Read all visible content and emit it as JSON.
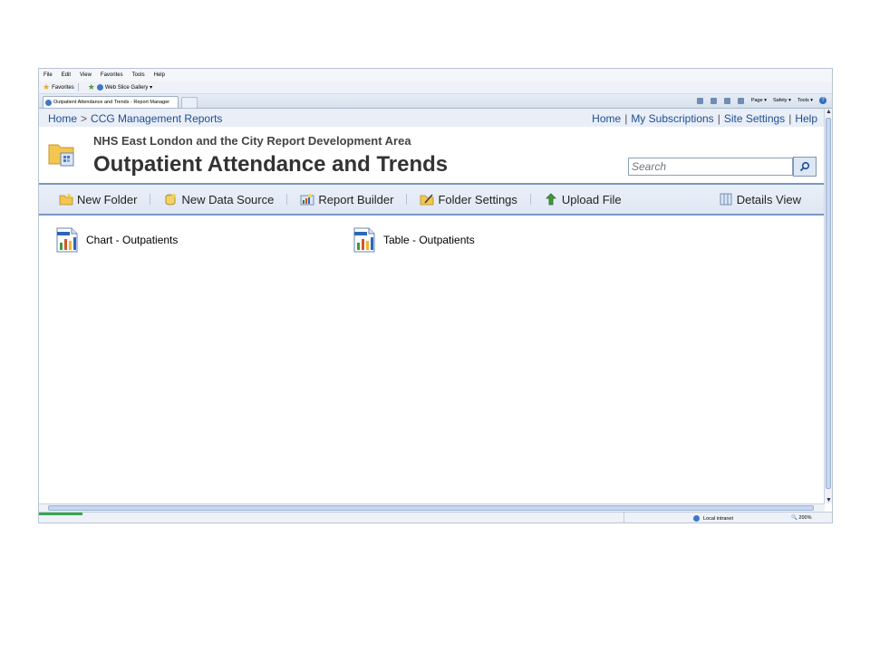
{
  "browser": {
    "menu": [
      "File",
      "Edit",
      "View",
      "Favorites",
      "Tools",
      "Help"
    ],
    "favorites_bar": {
      "favorites_label": "Favorites",
      "web_slice_label": "Web Slice Gallery ▾"
    },
    "tab_title": "Outpatient Attendance and Trends - Report Manager",
    "commands": {
      "page": "Page ▾",
      "safety": "Safety ▾",
      "tools": "Tools ▾"
    },
    "status": {
      "zone": "Local intranet",
      "zoom": "200%"
    }
  },
  "topnav": {
    "breadcrumb": [
      "Home",
      "CCG Management Reports"
    ],
    "breadcrumb_sep": ">",
    "links": [
      "Home",
      "My Subscriptions",
      "Site Settings",
      "Help"
    ],
    "link_sep": "|"
  },
  "header": {
    "subtitle": "NHS East London and the City Report Development Area",
    "title": "Outpatient Attendance and Trends",
    "search_placeholder": "Search"
  },
  "toolbar": {
    "new_folder": "New Folder",
    "new_data_source": "New Data Source",
    "report_builder": "Report Builder",
    "folder_settings": "Folder Settings",
    "upload_file": "Upload File",
    "details_view": "Details View"
  },
  "reports": [
    "Chart - Outpatients",
    "Table - Outpatients"
  ],
  "colors": {
    "link": "#1f4e93",
    "toolbar_border": "#7a96c5",
    "nav_bg": "#e9eef7"
  }
}
